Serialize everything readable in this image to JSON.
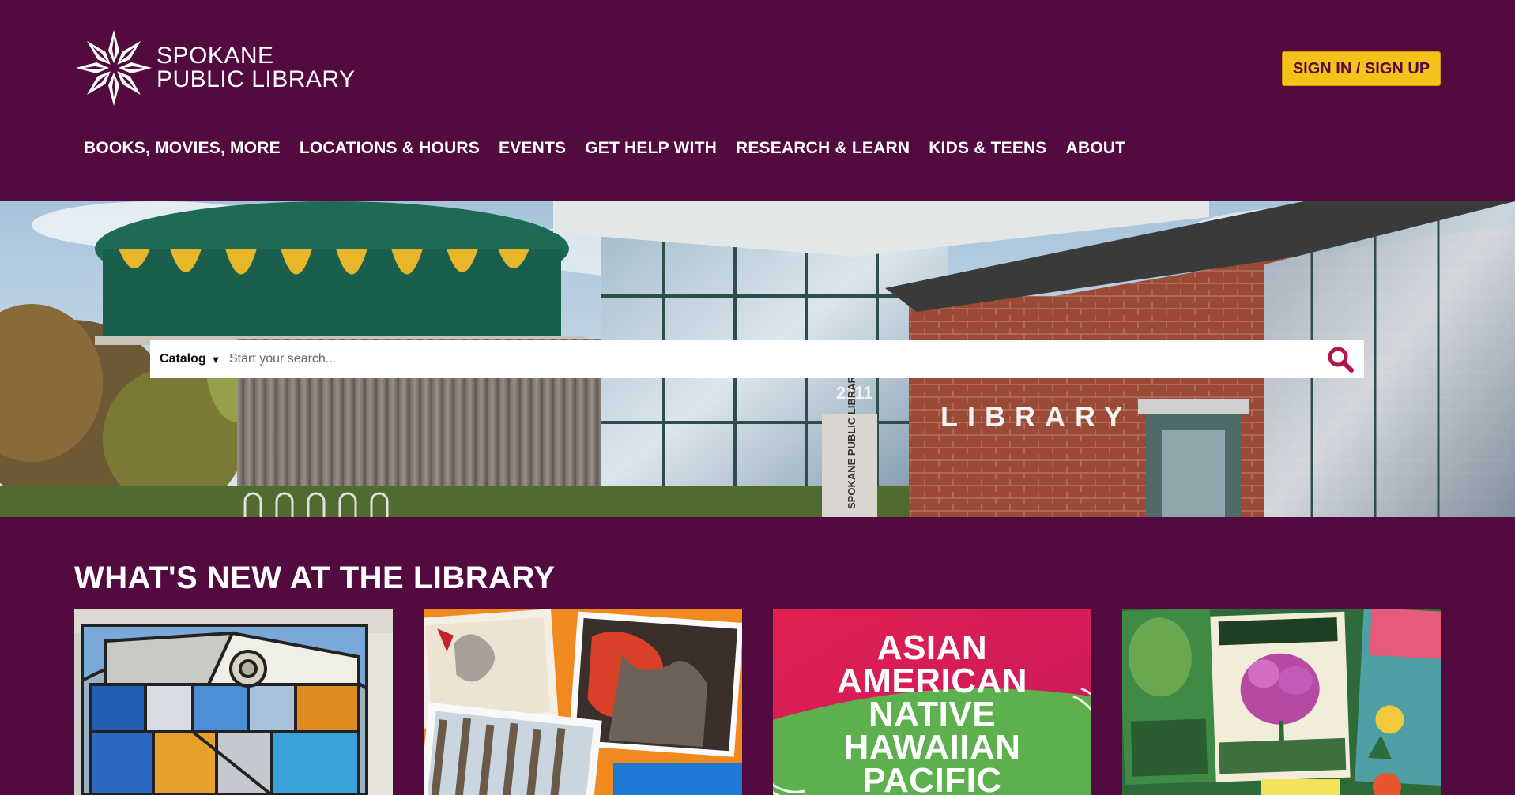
{
  "header": {
    "logo_line1": "SPOKANE",
    "logo_line2": "PUBLIC LIBRARY",
    "signin_label": "SIGN IN / SIGN UP"
  },
  "nav": {
    "items": [
      {
        "label": "BOOKS, MOVIES, MORE"
      },
      {
        "label": "LOCATIONS & HOURS"
      },
      {
        "label": "EVENTS"
      },
      {
        "label": "GET HELP WITH"
      },
      {
        "label": "RESEARCH & LEARN"
      },
      {
        "label": "KIDS & TEENS"
      },
      {
        "label": "ABOUT"
      }
    ]
  },
  "search": {
    "category": "Catalog",
    "category_arrow": "▼",
    "placeholder": "Start your search..."
  },
  "hero": {
    "building_sign": "LIBRARY",
    "building_number": "2111",
    "vertical_sign": "SPOKANE PUBLIC LIBRARY"
  },
  "news": {
    "title": "WHAT'S NEW AT THE LIBRARY",
    "cards": [
      {
        "kind": "stained-glass"
      },
      {
        "kind": "art-collage"
      },
      {
        "kind": "heritage-month",
        "lines": [
          "ASIAN",
          "AMERICAN",
          "NATIVE",
          "HAWAIIAN",
          "PACIFIC"
        ]
      },
      {
        "kind": "gardening-books"
      }
    ]
  },
  "colors": {
    "brand": "#530a3e",
    "accent": "#f5c318",
    "search_icon": "#b3164e"
  },
  "icons": {
    "search": "search-icon",
    "logo": "star-flower-logo-icon"
  }
}
